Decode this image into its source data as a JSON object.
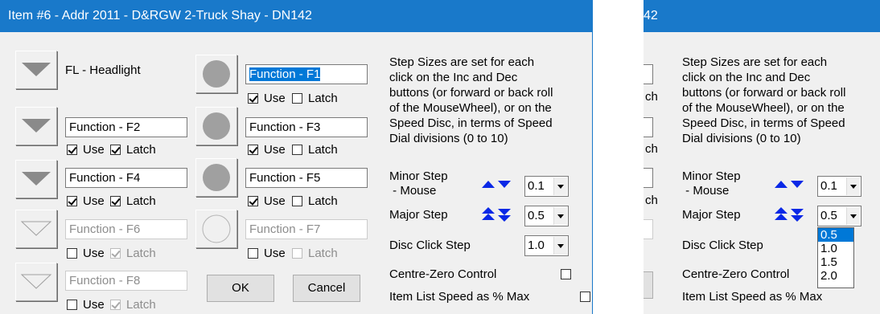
{
  "dialog": {
    "title": "Item #6 - Addr 2011 - D&RGW 2-Truck Shay - DN142",
    "title_partial": "42",
    "fl_label": "FL - Headlight",
    "functions": [
      {
        "name": "Function - F1",
        "use_label": "Use",
        "latch_label": "Latch"
      },
      {
        "name": "Function - F2",
        "use_label": "Use",
        "latch_label": "Latch"
      },
      {
        "name": "Function - F3",
        "use_label": "Use",
        "latch_label": "Latch"
      },
      {
        "name": "Function - F4",
        "use_label": "Use",
        "latch_label": "Latch"
      },
      {
        "name": "Function - F5",
        "use_label": "Use",
        "latch_label": "Latch"
      },
      {
        "name": "Function - F6",
        "use_label": "Use",
        "latch_label": "Latch"
      },
      {
        "name": "Function - F7",
        "use_label": "Use",
        "latch_label": "Latch"
      },
      {
        "name": "Function - F8",
        "use_label": "Use",
        "latch_label": "Latch"
      }
    ],
    "ok_label": "OK",
    "cancel_label": "Cancel",
    "step_text": [
      "Step Sizes are set for each",
      "click on the Inc and Dec",
      "buttons (or forward or back roll",
      "of the MouseWheel), or on the",
      "Speed Disc, in terms of Speed",
      "Dial divisions (0 to 10)"
    ],
    "minor_step_label_1": "Minor Step",
    "minor_step_label_2": " - Mouse",
    "major_step_label": "Major Step",
    "disc_click_label": "Disc Click Step",
    "minor_step_value": "0.1",
    "major_step_value": "0.5",
    "disc_click_value": "1.0",
    "centre_zero_label": "Centre-Zero Control",
    "item_list_label": "Item List Speed as % Max",
    "major_step_options": [
      "0.5",
      "1.0",
      "1.5",
      "2.0"
    ],
    "partial_labels": [
      "ch",
      "ch",
      "ch"
    ]
  },
  "colors": {
    "title_bg": "#1979ca",
    "arrow_blue": "#0a28e6",
    "selection": "#0078d7"
  }
}
